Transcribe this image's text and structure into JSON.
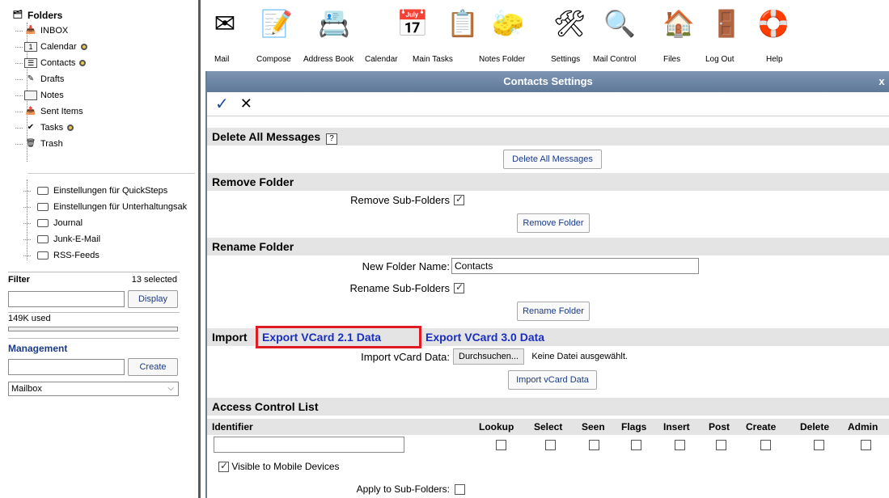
{
  "sidebar": {
    "root_label": "Folders",
    "folders": [
      {
        "label": "INBOX",
        "icon": "inbox-icon",
        "badge": false
      },
      {
        "label": "Calendar",
        "icon": "calendar-icon",
        "badge": true
      },
      {
        "label": "Contacts",
        "icon": "contacts-icon",
        "badge": true
      },
      {
        "label": "Drafts",
        "icon": "drafts-icon",
        "badge": false
      },
      {
        "label": "Notes",
        "icon": "notes-icon",
        "badge": false
      },
      {
        "label": "Sent Items",
        "icon": "sent-icon",
        "badge": false
      },
      {
        "label": "Tasks",
        "icon": "tasks-icon",
        "badge": true
      },
      {
        "label": "Trash",
        "icon": "trash-icon",
        "badge": false
      }
    ],
    "extra_folders": [
      "Einstellungen für QuickSteps",
      "Einstellungen für Unterhaltungsak",
      "Journal",
      "Junk-E-Mail",
      "RSS-Feeds"
    ],
    "filter_label": "Filter",
    "filter_count": "13 selected",
    "display_button": "Display",
    "usage": "149K used",
    "management_label": "Management",
    "create_button": "Create",
    "mailbox_select": "Mailbox"
  },
  "toolbar": {
    "items": [
      {
        "label": "Mail",
        "icon": "mail-icon"
      },
      {
        "label": "Compose",
        "icon": "compose-icon"
      },
      {
        "label": "Address Book",
        "icon": "address-book-icon"
      },
      {
        "label": "Calendar",
        "icon": "calendar-icon"
      },
      {
        "label": "Main Tasks",
        "icon": "tasks-icon"
      },
      {
        "label": "Notes Folder",
        "icon": "notes-icon"
      },
      {
        "label": "Settings",
        "icon": "settings-icon"
      },
      {
        "label": "Mail Control",
        "icon": "mail-control-icon"
      },
      {
        "label": "Files",
        "icon": "files-icon"
      },
      {
        "label": "Log Out",
        "icon": "logout-icon"
      },
      {
        "label": "Help",
        "icon": "help-icon"
      }
    ]
  },
  "dialog": {
    "title": "Contacts Settings",
    "close": "x",
    "delete_section": "Delete All Messages",
    "help_mark": "?",
    "delete_button": "Delete All Messages",
    "remove_section": "Remove Folder",
    "remove_sub_label": "Remove Sub-Folders",
    "remove_sub_checked": true,
    "remove_button": "Remove Folder",
    "rename_section": "Rename Folder",
    "new_name_label": "New Folder Name:",
    "new_name_value": "Contacts",
    "rename_sub_label": "Rename Sub-Folders",
    "rename_sub_checked": true,
    "rename_button": "Rename Folder",
    "import_section": "Import",
    "export21": "Export VCard 2.1 Data",
    "export30": "Export VCard 3.0 Data",
    "import_label": "Import vCard Data:",
    "browse_button": "Durchsuchen...",
    "no_file": "Keine Datei ausgewählt.",
    "import_button": "Import vCard Data",
    "acl_section": "Access Control List",
    "acl_columns": [
      "Identifier",
      "Lookup",
      "Select",
      "Seen",
      "Flags",
      "Insert",
      "Post",
      "Create",
      "Delete",
      "Admin"
    ],
    "visible_mobile": "Visible to Mobile Devices",
    "visible_mobile_checked": true,
    "apply_sub": "Apply to Sub-Folders:",
    "apply_sub_checked": false
  },
  "colors": {
    "title_bar": "#6f86a6",
    "link": "#1a2fbf",
    "highlight": "#e01b24",
    "button_text": "#1a3a8a"
  }
}
